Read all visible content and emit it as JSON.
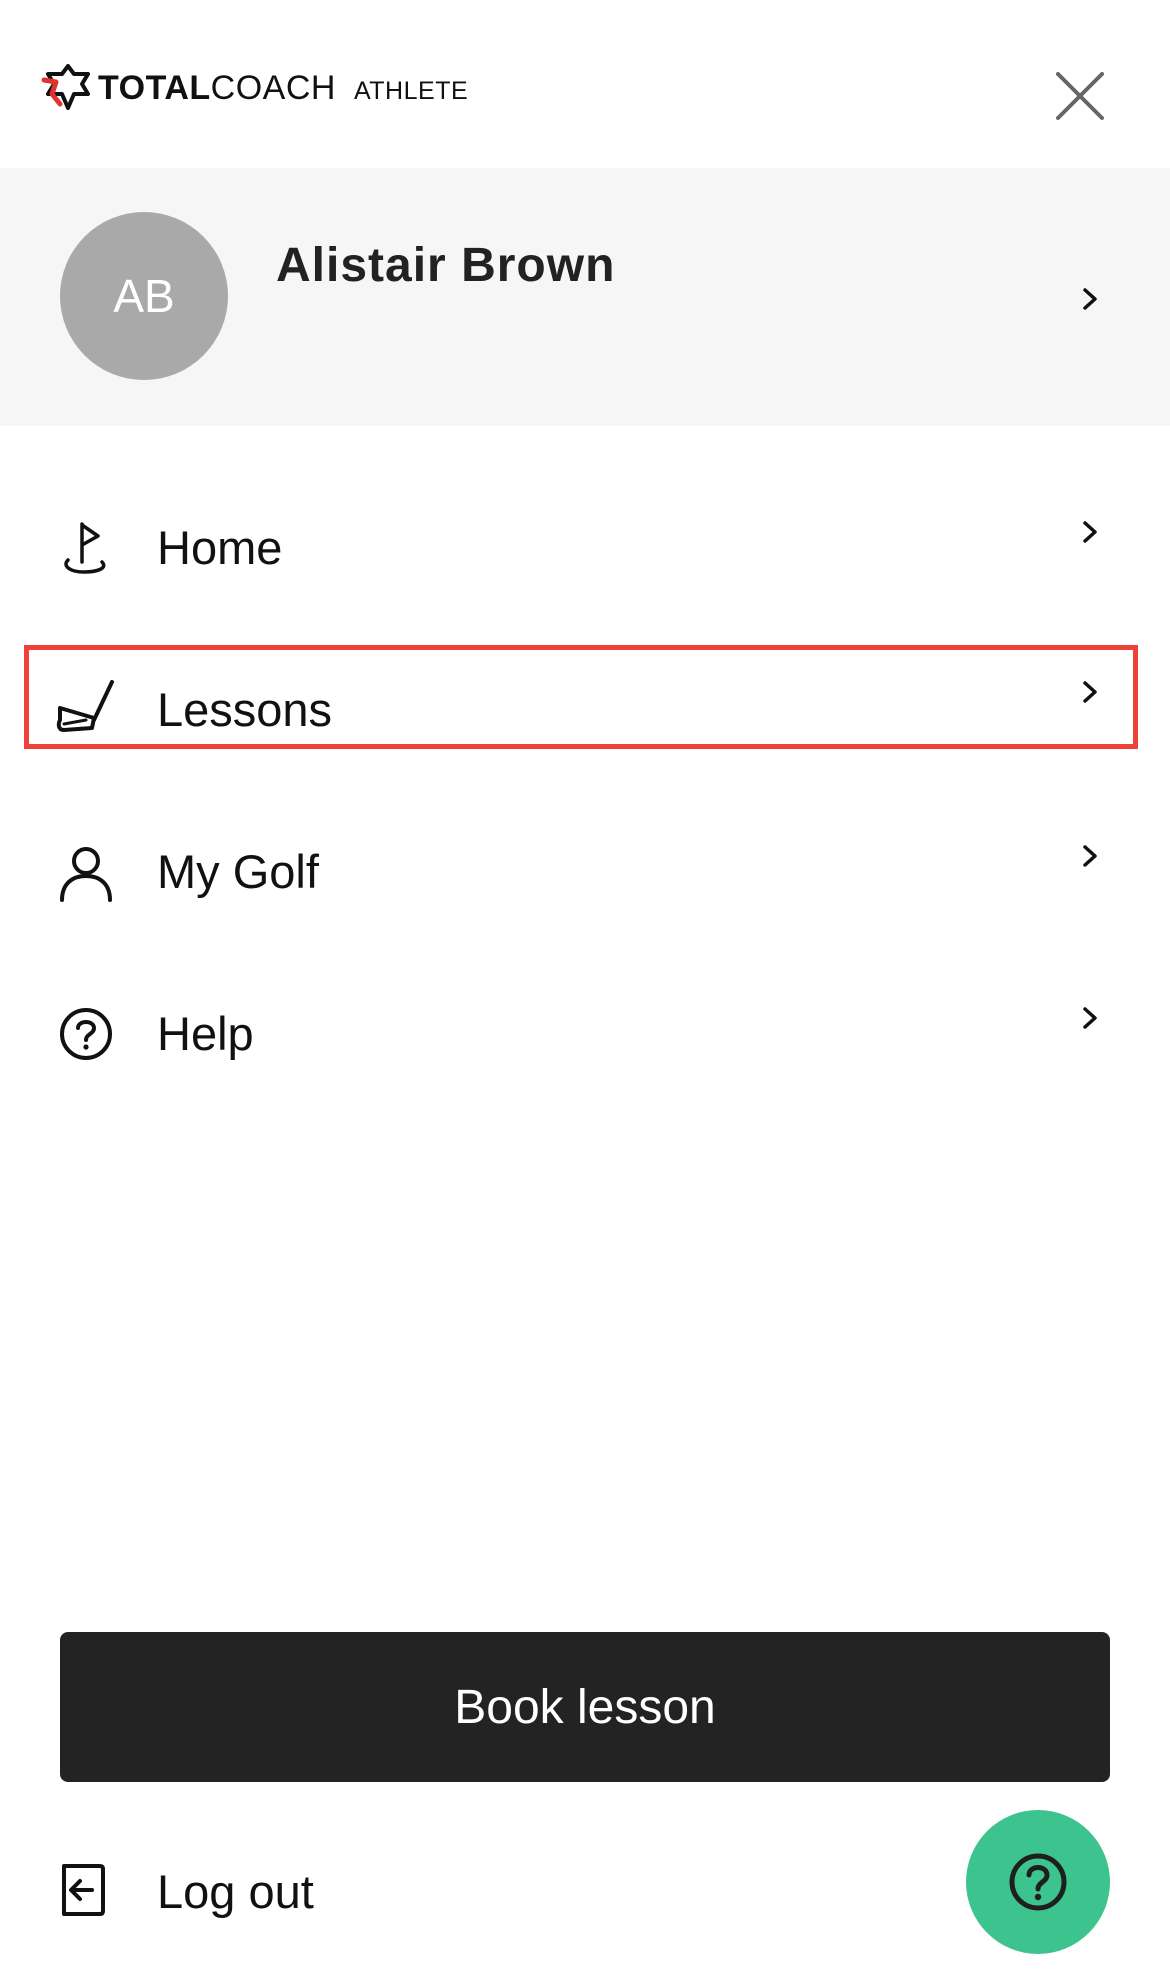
{
  "header": {
    "logo_total": "TOTAL",
    "logo_coach": "COACH",
    "logo_athlete": "ATHLETE",
    "close_icon": "close-icon"
  },
  "profile": {
    "initials": "AB",
    "name": "Alistair Brown"
  },
  "menu": {
    "items": [
      {
        "label": "Home",
        "icon": "golf-flag-icon"
      },
      {
        "label": "Lessons",
        "icon": "golf-club-icon",
        "highlighted": true
      },
      {
        "label": "My Golf",
        "icon": "person-icon"
      },
      {
        "label": "Help",
        "icon": "question-circle-icon"
      }
    ]
  },
  "actions": {
    "book_lesson": "Book lesson",
    "logout": "Log out"
  },
  "colors": {
    "brand_red": "#e0332e",
    "highlight": "#f0403a",
    "profile_bg": "#f6f6f6",
    "avatar_bg": "#a9a9a9",
    "book_button_bg": "#232323",
    "fab_bg": "#3dc48e"
  }
}
